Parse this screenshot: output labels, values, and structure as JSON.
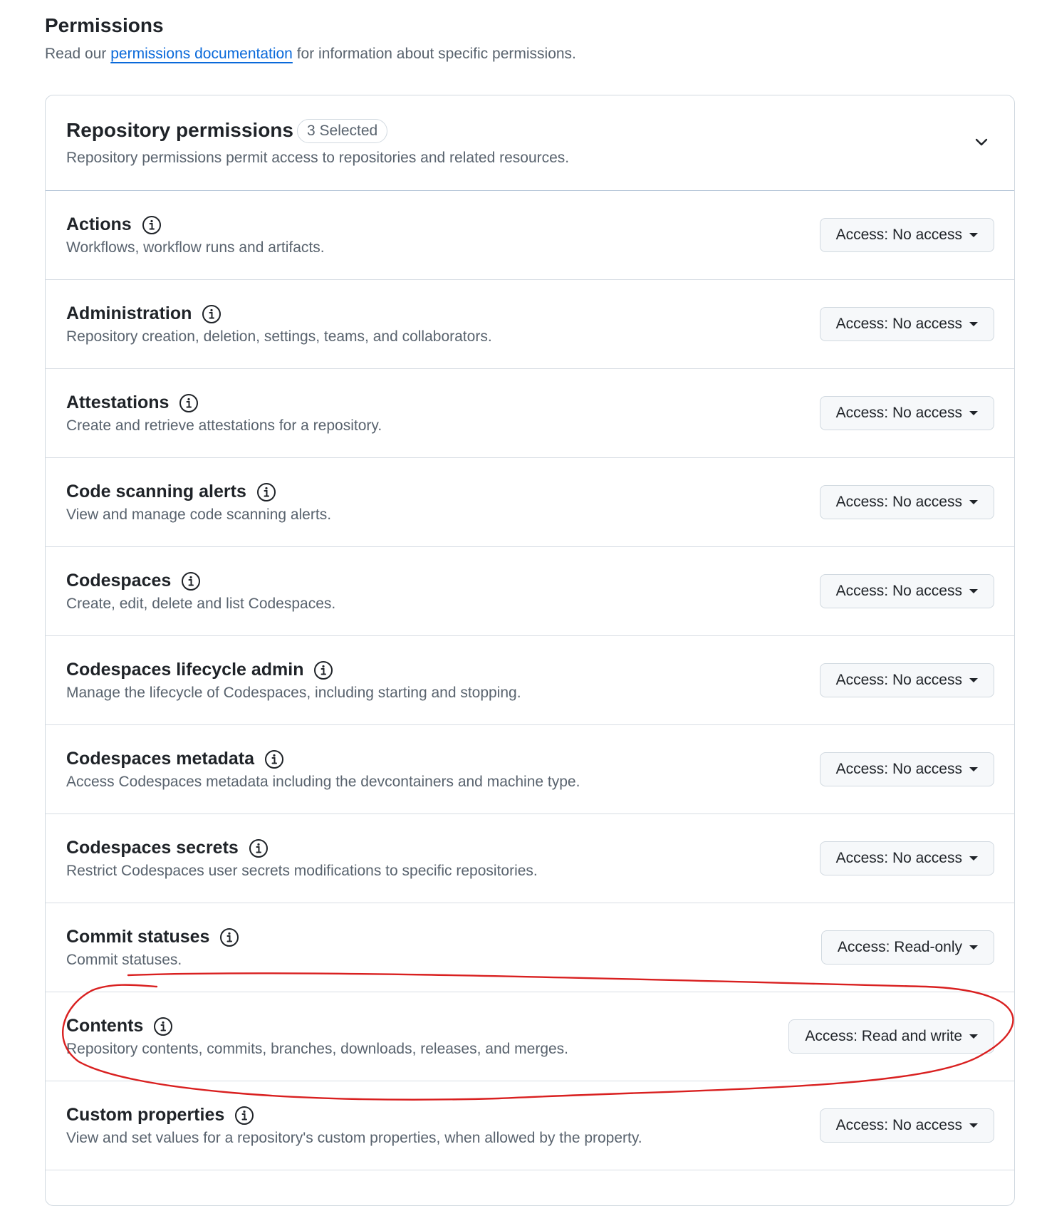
{
  "header": {
    "title": "Permissions",
    "subtitle_prefix": "Read our ",
    "doc_link": "permissions documentation",
    "subtitle_suffix": " for information about specific permissions."
  },
  "panel": {
    "title": "Repository permissions",
    "badge": "3 Selected",
    "description": "Repository permissions permit access to repositories and related resources."
  },
  "permissions": [
    {
      "title": "Actions",
      "description": "Workflows, workflow runs and artifacts.",
      "access": "Access: No access"
    },
    {
      "title": "Administration",
      "description": "Repository creation, deletion, settings, teams, and collaborators.",
      "access": "Access: No access"
    },
    {
      "title": "Attestations",
      "description": "Create and retrieve attestations for a repository.",
      "access": "Access: No access"
    },
    {
      "title": "Code scanning alerts",
      "description": "View and manage code scanning alerts.",
      "access": "Access: No access"
    },
    {
      "title": "Codespaces",
      "description": "Create, edit, delete and list Codespaces.",
      "access": "Access: No access"
    },
    {
      "title": "Codespaces lifecycle admin",
      "description": "Manage the lifecycle of Codespaces, including starting and stopping.",
      "access": "Access: No access"
    },
    {
      "title": "Codespaces metadata",
      "description": "Access Codespaces metadata including the devcontainers and machine type.",
      "access": "Access: No access"
    },
    {
      "title": "Codespaces secrets",
      "description": "Restrict Codespaces user secrets modifications to specific repositories.",
      "access": "Access: No access"
    },
    {
      "title": "Commit statuses",
      "description": "Commit statuses.",
      "access": "Access: Read-only"
    },
    {
      "title": "Contents",
      "description": "Repository contents, commits, branches, downloads, releases, and merges.",
      "access": "Access: Read and write"
    },
    {
      "title": "Custom properties",
      "description": "View and set values for a repository's custom properties, when allowed by the property.",
      "access": "Access: No access"
    }
  ],
  "icons": {
    "info": "info-circle-icon",
    "chevron": "chevron-down-icon",
    "caret": "caret-down-icon"
  },
  "colors": {
    "link": "#0969da",
    "annotation": "#d92020",
    "muted_text": "#59636e"
  }
}
